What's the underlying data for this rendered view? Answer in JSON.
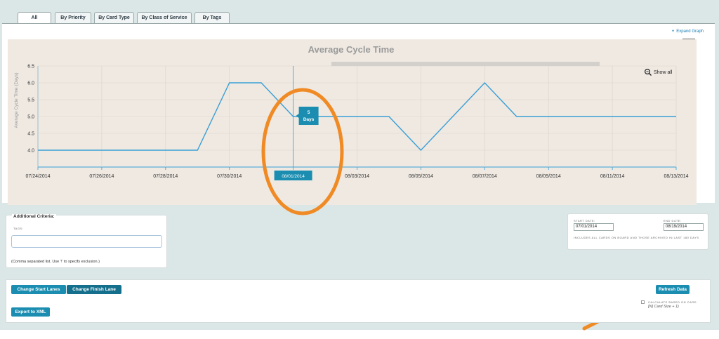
{
  "tabs": [
    "All",
    "By Priority",
    "By Card Type",
    "By Class of Service",
    "By Tags"
  ],
  "expand_graph": "Expand Graph",
  "help": "?",
  "show_all": "Show all",
  "chart_data": {
    "type": "line",
    "title": "Average Cycle Time",
    "ylabel": "Average Cycle Time (Days)",
    "xlabel": "",
    "x": [
      "07/24/2014",
      "07/25/2014",
      "07/26/2014",
      "07/27/2014",
      "07/28/2014",
      "07/29/2014",
      "07/30/2014",
      "07/31/2014",
      "08/01/2014",
      "08/02/2014",
      "08/03/2014",
      "08/04/2014",
      "08/05/2014",
      "08/06/2014",
      "08/07/2014",
      "08/08/2014",
      "08/09/2014",
      "08/10/2014",
      "08/11/2014",
      "08/12/2014",
      "08/13/2014"
    ],
    "values": [
      4.0,
      4.0,
      4.0,
      4.0,
      4.0,
      4.0,
      6.0,
      6.0,
      5.0,
      5.0,
      5.0,
      5.0,
      4.0,
      5.0,
      6.0,
      5.0,
      5.0,
      5.0,
      5.0,
      5.0,
      5.0
    ],
    "x_ticks": [
      "07/24/2014",
      "07/26/2014",
      "07/28/2014",
      "07/30/2014",
      "08/01/2014",
      "08/03/2014",
      "08/05/2014",
      "08/07/2014",
      "08/09/2014",
      "08/11/2014",
      "08/13/2014"
    ],
    "y_ticks": [
      "4.0",
      "4.5",
      "5.0",
      "5.5",
      "6.0",
      "6.5"
    ],
    "ylim": [
      3.5,
      6.5
    ],
    "grid": true,
    "line_color": "#3a9fd6",
    "tooltip": {
      "value": "5",
      "unit": "Days",
      "x_label": "08/01/2014"
    }
  },
  "criteria": {
    "title": "Additional Criteria:",
    "tags_label": "TAGS:",
    "tags_value": "",
    "hint": "(Comma separated list. Use '!' to specify exclusion.)"
  },
  "dates": {
    "start_label": "START DATE:",
    "start_value": "07/01/2014",
    "end_label": "END DATE:",
    "end_value": "08/19/2014",
    "note": "INCLUDES ALL CARDS ON BOARD AND THOSE ARCHIVED IN LAST 180 DAYS"
  },
  "actions": {
    "change_start": "Change Start Lanes",
    "change_finish": "Change Finish Lane",
    "export": "Export to XML",
    "refresh": "Refresh Data",
    "calc_label": "CALCULATE BASED ON CARD",
    "calc_sub": "[N] Card Size + 1)"
  },
  "colors": {
    "accent": "#1a8db0",
    "annotation": "#f08a24",
    "chart_bg": "#efe9e2"
  }
}
